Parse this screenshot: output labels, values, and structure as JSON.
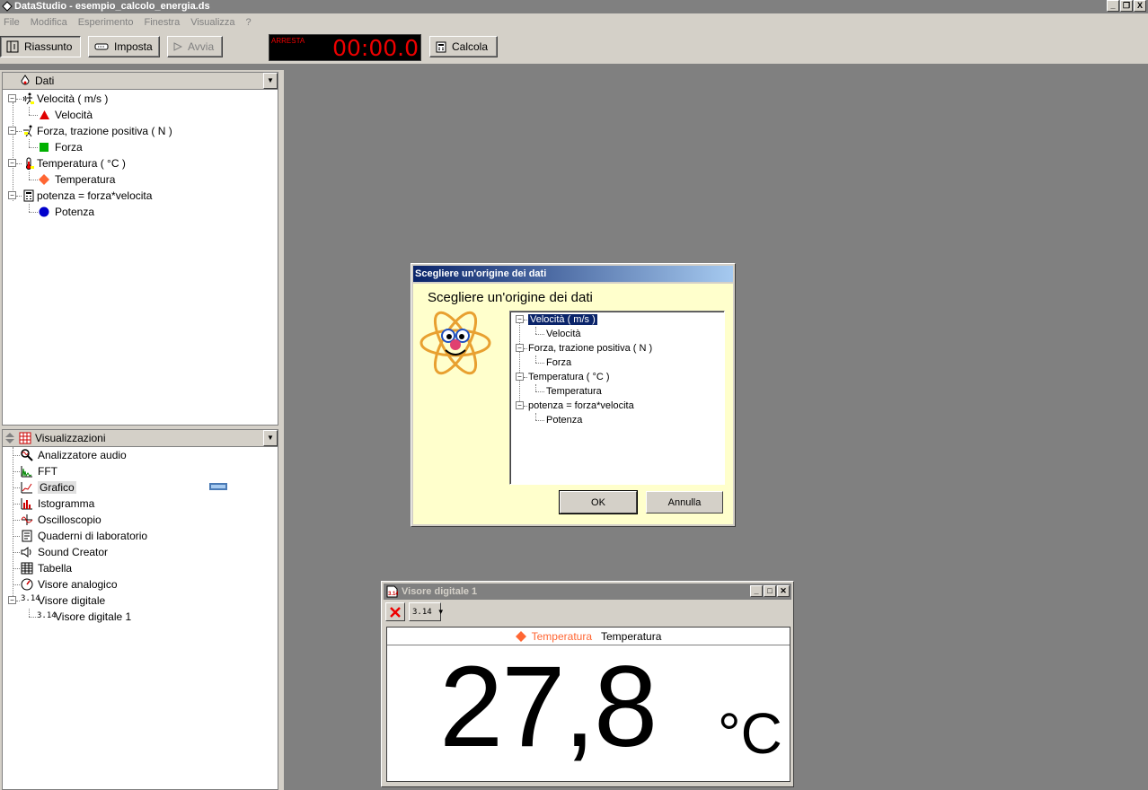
{
  "window": {
    "title": "DataStudio - esempio_calcolo_energia.ds",
    "buttons": [
      "_",
      "❒",
      "X"
    ]
  },
  "menu": [
    "File",
    "Modifica",
    "Esperimento",
    "Finestra",
    "Visualizza",
    "?"
  ],
  "toolbar": {
    "summary": "Riassunto",
    "setup": "Imposta",
    "start": "Avvia",
    "timer_label": "ARRESTA",
    "timer_value": "00:00.0",
    "calculate": "Calcola"
  },
  "data_panel": {
    "title": "Dati",
    "groups": [
      {
        "label": "Velocità ( m/s )",
        "child": "Velocità",
        "color": "#e00000"
      },
      {
        "label": "Forza, trazione positiva ( N )",
        "child": "Forza",
        "color": "#00b000"
      },
      {
        "label": "Temperatura ( °C )",
        "child": "Temperatura",
        "color": "#ff6633"
      },
      {
        "label": "potenza = forza*velocita",
        "child": "Potenza",
        "color": "#0000cc"
      }
    ]
  },
  "displays_panel": {
    "title": "Visualizzazioni",
    "items": [
      "Analizzatore audio",
      "FFT",
      "Grafico",
      "Istogramma",
      "Oscilloscopio",
      "Quaderni di laboratorio",
      "Sound Creator",
      "Tabella",
      "Visore analogico",
      "Visore digitale"
    ],
    "selected": "Grafico",
    "sub_item": "Visore digitale 1",
    "sub_icon_text": "3.14"
  },
  "dialog": {
    "title": "Scegliere un'origine dei dati",
    "heading": "Scegliere un'origine dei dati",
    "tree": [
      {
        "label": "Velocità ( m/s )",
        "child": "Velocità"
      },
      {
        "label": "Forza, trazione positiva ( N )",
        "child": "Forza"
      },
      {
        "label": "Temperatura ( °C )",
        "child": "Temperatura"
      },
      {
        "label": "potenza = forza*velocita",
        "child": "Potenza"
      }
    ],
    "ok": "OK",
    "cancel": "Annulla"
  },
  "digital_display": {
    "title": "Visore digitale 1",
    "toolbar_icon_text": "3.14",
    "legend_series": "Temperatura",
    "legend_measure": "Temperatura",
    "value": "27,8",
    "unit": "°C",
    "series_color": "#ff6633"
  }
}
